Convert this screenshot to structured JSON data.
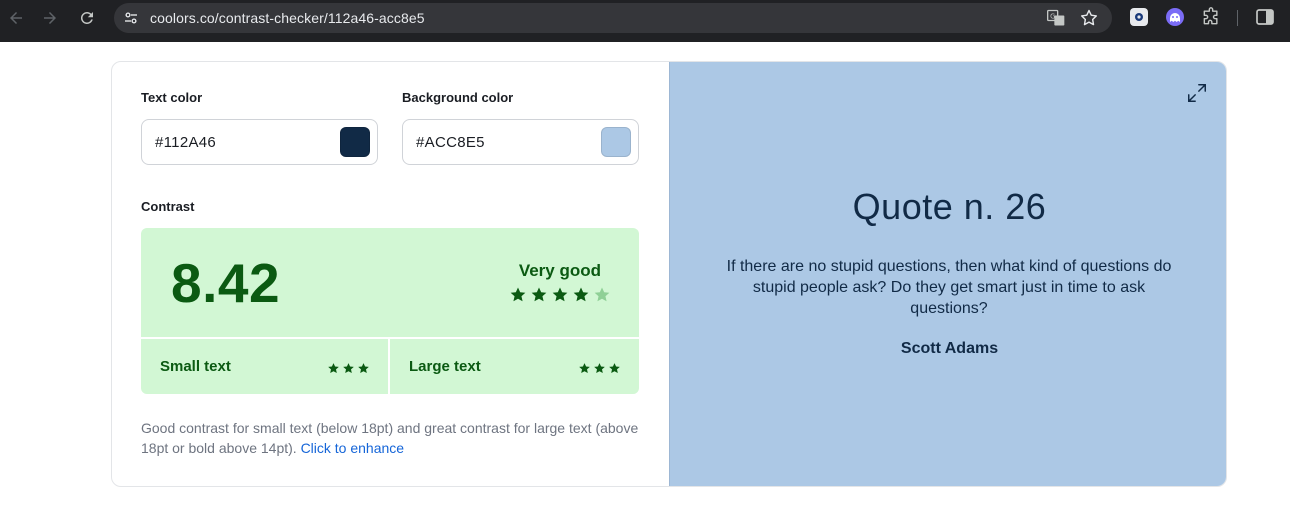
{
  "browser": {
    "url": "coolors.co/contrast-checker/112a46-acc8e5"
  },
  "checker": {
    "text_color_label": "Text color",
    "text_color_value": "#112A46",
    "background_color_label": "Background color",
    "background_color_value": "#ACC8E5",
    "contrast_label": "Contrast",
    "score": "8.42",
    "rating": "Very good",
    "rating_stars": 4,
    "rating_stars_total": 5,
    "small_text_label": "Small text",
    "small_text_stars": 3,
    "large_text_label": "Large text",
    "large_text_stars": 3,
    "description": "Good contrast for small text (below 18pt) and great contrast for large text (above 18pt or bold above 14pt).",
    "enhance_link": "Click to enhance"
  },
  "preview": {
    "title": "Quote n. 26",
    "quote": "If there are no stupid questions, then what kind of questions do stupid people ask? Do they get smart just in time to ask questions?",
    "author": "Scott Adams"
  },
  "colors": {
    "text_color": "#112a46",
    "background_color": "#acc8e5",
    "good_green": "#0b5a12",
    "good_bg": "#d2f7d4",
    "link": "#1565d8"
  },
  "icons": [
    "back-arrow-icon",
    "forward-arrow-icon",
    "reload-icon",
    "site-settings-icon",
    "translate-icon",
    "bookmark-star-icon",
    "extension-icon",
    "puzzle-icon",
    "side-panel-icon",
    "expand-icon",
    "star-icon"
  ]
}
